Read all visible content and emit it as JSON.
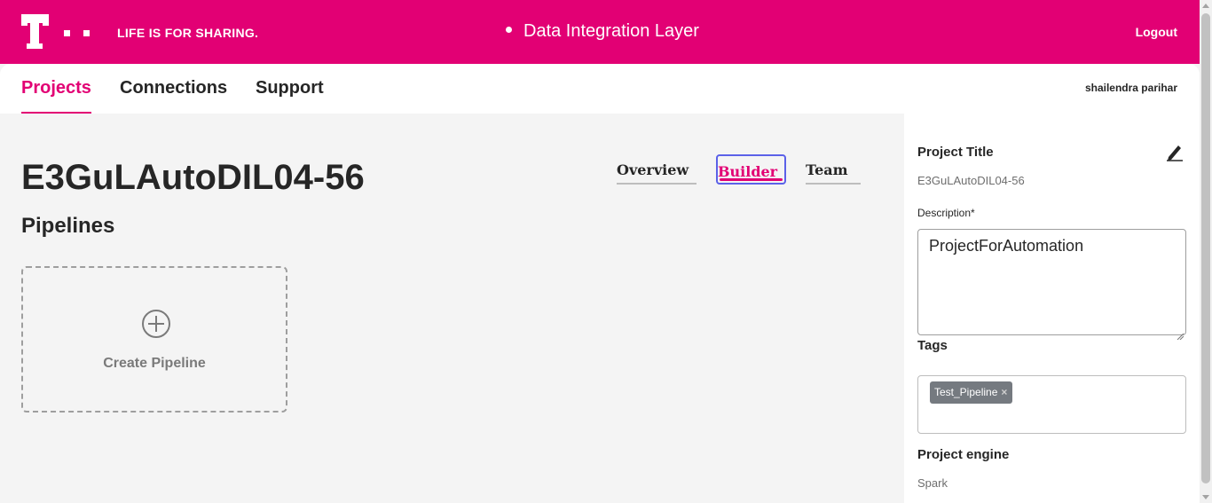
{
  "header": {
    "tagline": "LIFE IS FOR SHARING.",
    "app_title": "Data Integration Layer",
    "logout_label": "Logout",
    "brand_color": "#e20074",
    "logo_icon": "telekom-t-logo-icon"
  },
  "nav": {
    "items": [
      {
        "label": "Projects",
        "active": true
      },
      {
        "label": "Connections",
        "active": false
      },
      {
        "label": "Support",
        "active": false
      }
    ],
    "username": "shailendra parihar"
  },
  "main": {
    "project_name": "E3GuLAutoDIL04-56",
    "section_title": "Pipelines",
    "tabs": [
      {
        "label": "Overview",
        "active": false
      },
      {
        "label": "Builder",
        "active": true
      },
      {
        "label": "Team",
        "active": false
      }
    ],
    "create_pipeline_label": "Create Pipeline",
    "create_icon": "plus-circle-icon"
  },
  "panel": {
    "project_title_label": "Project Title",
    "project_title_value": "E3GuLAutoDIL04-56",
    "edit_icon": "pencil-icon",
    "description_label": "Description*",
    "description_value": "ProjectForAutomation",
    "tags_label": "Tags",
    "tags": [
      {
        "label": "Test_Pipeline",
        "remove_glyph": "×"
      }
    ],
    "engine_label": "Project engine",
    "engine_value": "Spark"
  }
}
